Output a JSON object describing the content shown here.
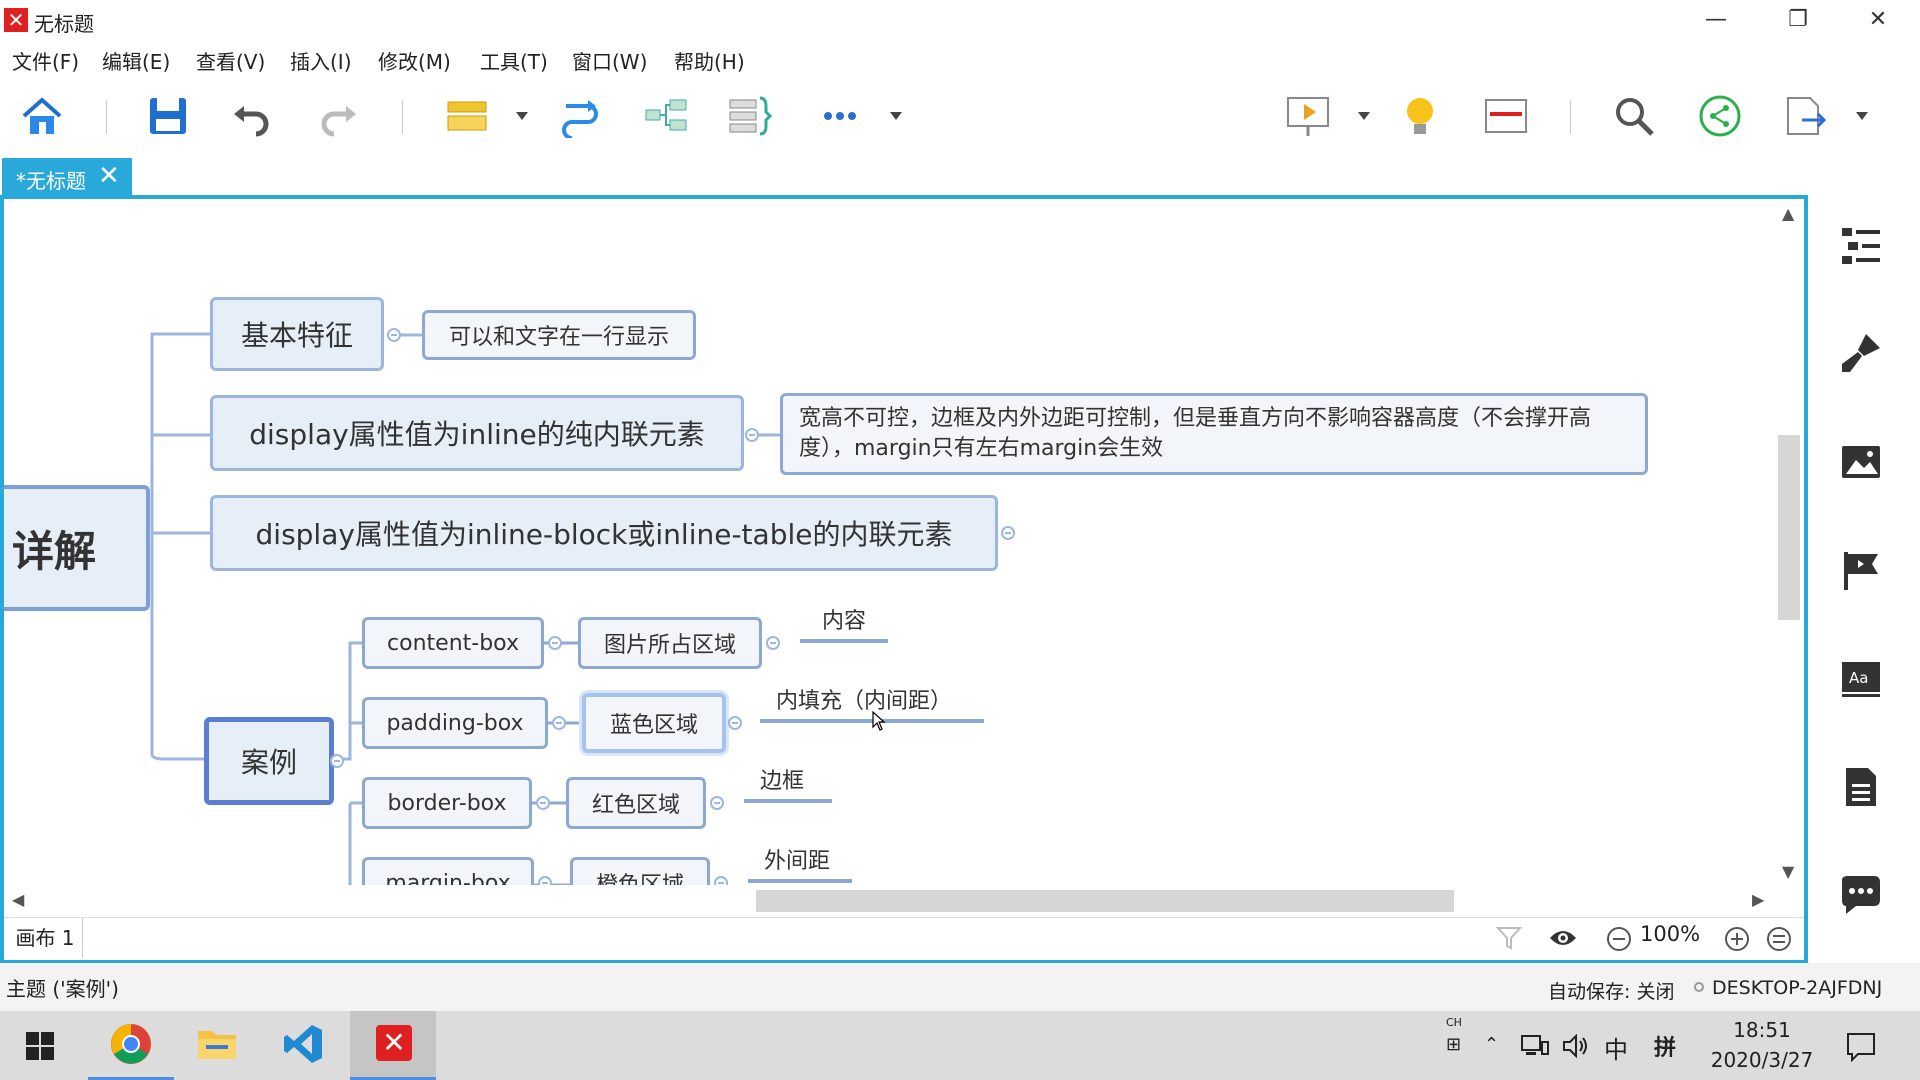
{
  "window": {
    "title": "无标题",
    "controls": [
      "—",
      "❐",
      "✕"
    ]
  },
  "menu": [
    "文件(F)",
    "编辑(E)",
    "查看(V)",
    "插入(I)",
    "修改(M)",
    "工具(T)",
    "窗口(W)",
    "帮助(H)"
  ],
  "toolbar": {
    "icons": [
      "home-icon",
      "save-icon",
      "undo-icon",
      "redo-icon",
      "topic-icon",
      "relationship-icon",
      "structure-icon",
      "summary-icon",
      "more-icon",
      "presentation-icon",
      "idea-icon",
      "outline-icon",
      "search-icon",
      "share-icon",
      "export-icon"
    ]
  },
  "tab": {
    "label": "*无标题",
    "close": "✕"
  },
  "mindmap": {
    "central": "详解",
    "topics": {
      "basic": "基本特征",
      "basic_note": "可以和文字在一行显示",
      "inline": "display属性值为inline的纯内联元素",
      "inline_note_line1": "宽高不可控，边框及内外边距可控制，但是垂直方向不影响容器高度（不会撑开高",
      "inline_note_line2": "度），margin只有左右margin会生效",
      "inline_block": "display属性值为inline-block或inline-table的内联元素",
      "case": "案例"
    },
    "cases": [
      {
        "box": "content-box",
        "area": "图片所占区域",
        "label": "内容"
      },
      {
        "box": "padding-box",
        "area": "蓝色区域",
        "label": "内填充（内间距）"
      },
      {
        "box": "border-box",
        "area": "红色区域",
        "label": "边框"
      },
      {
        "box": "margin-box",
        "area": "橙色区域",
        "label": "外间距"
      }
    ]
  },
  "sheet": {
    "name": "画布 1",
    "zoom": "100%"
  },
  "status": {
    "selection": "主题 ('案例')",
    "autosave": "自动保存: 关闭",
    "host": "DESKTOP-2AJFDNJ"
  },
  "taskbar": {
    "time": "18:51",
    "date": "2020/3/27",
    "ime": "中",
    "ime_mode": "拼",
    "apps": [
      "start-icon",
      "chrome-icon",
      "file-explorer-icon",
      "vscode-icon",
      "xmind-icon"
    ]
  },
  "colors": {
    "accent": "#29a9d9",
    "node_fill": "#e6eef8",
    "node_border": "#9cb6df",
    "logo": "#e02020"
  }
}
